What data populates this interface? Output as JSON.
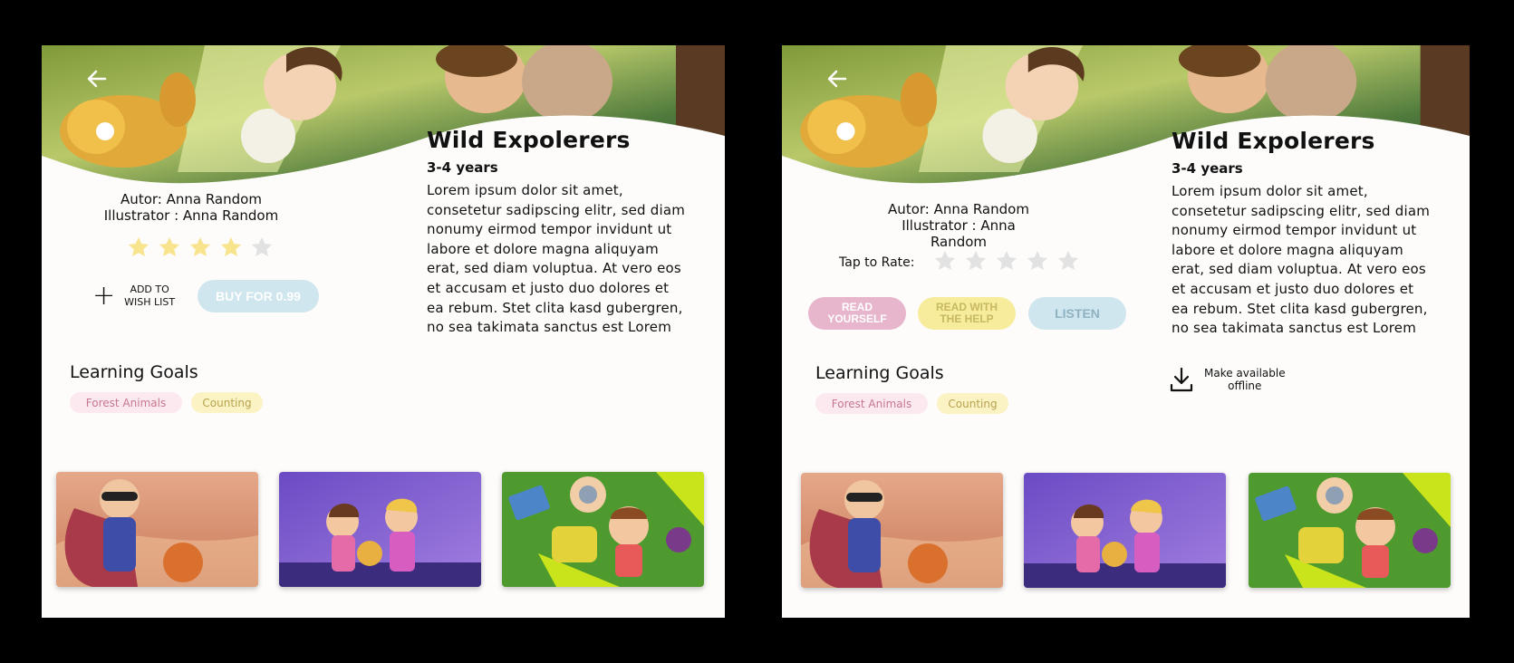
{
  "book": {
    "title": "Wild Expolerers",
    "age": "3-4 years",
    "description": "Lorem ipsum dolor sit amet, consetetur sadipscing elitr, sed diam nonumy eirmod tempor invidunt ut labore et dolore magna aliquyam erat, sed diam voluptua. At vero eos et accusam et justo duo dolores et ea rebum. Stet clita kasd gubergren, no sea takimata sanctus est Lorem",
    "author": "Autor: Anna Random",
    "illustrator": "Illustrator : Anna Random"
  },
  "screen_a": {
    "rating": 4,
    "rating_max": 5,
    "wishlist_line1": "ADD TO",
    "wishlist_line2": "WISH LIST",
    "buy_label": "BUY FOR 0.99"
  },
  "screen_b": {
    "rate_label": "Tap to Rate:",
    "rating": 0,
    "rating_max": 5,
    "read_yourself_line1": "READ",
    "read_yourself_line2": "YOURSELF",
    "read_help_line1": "READ WITH",
    "read_help_line2": "THE HELP",
    "listen_label": "LISTEN",
    "offline_line1": "Make available",
    "offline_line2": "offline"
  },
  "learning_goals": {
    "title": "Learning Goals",
    "tags": [
      "Forest Animals",
      "Counting"
    ]
  },
  "colors": {
    "star_filled": "#f7e48d",
    "star_empty": "#e2e2e2",
    "background": "#000000",
    "card": "#fdfcfb"
  },
  "icons": {
    "back": "arrow-left-icon",
    "plus": "plus-icon",
    "download": "download-icon",
    "star": "star-icon"
  }
}
